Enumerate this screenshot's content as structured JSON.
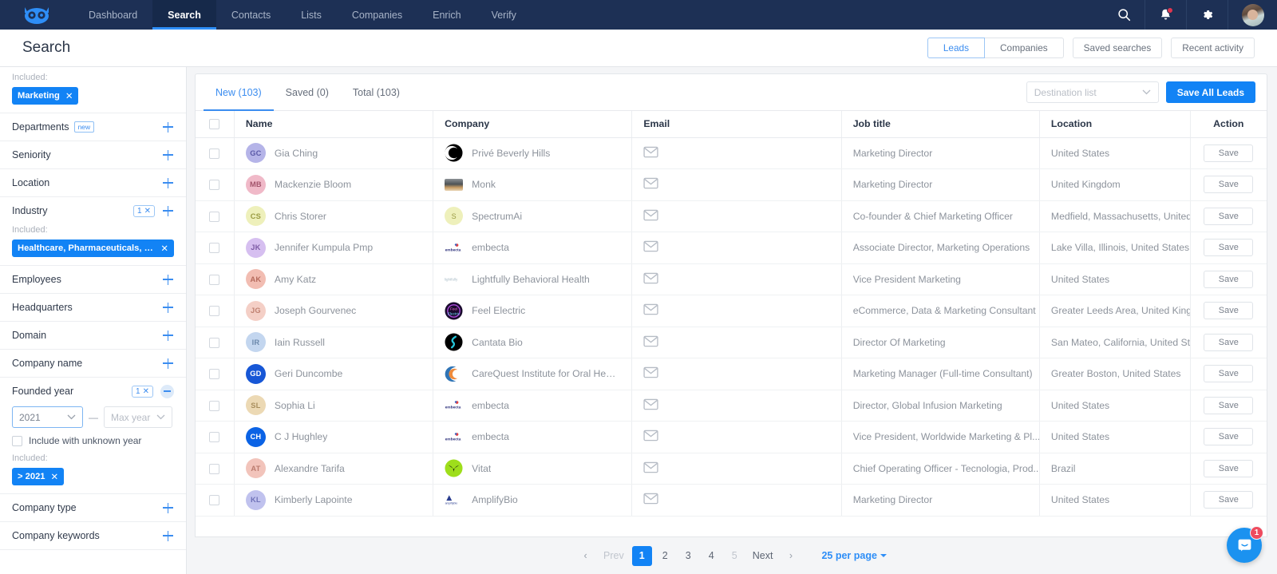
{
  "nav": {
    "logo_icon": "owl-logo-icon",
    "items": [
      {
        "label": "Dashboard",
        "active": false
      },
      {
        "label": "Search",
        "active": true
      },
      {
        "label": "Contacts",
        "active": false
      },
      {
        "label": "Lists",
        "active": false
      },
      {
        "label": "Companies",
        "active": false
      },
      {
        "label": "Enrich",
        "active": false
      },
      {
        "label": "Verify",
        "active": false
      }
    ],
    "icons": [
      "search-icon",
      "notifications-bell-icon",
      "settings-gear-icon",
      "user-avatar"
    ]
  },
  "header": {
    "title": "Search",
    "segmented": [
      {
        "label": "Leads",
        "active": true
      },
      {
        "label": "Companies",
        "active": false
      }
    ],
    "saved_searches": "Saved searches",
    "recent_activity": "Recent activity"
  },
  "sidebar": {
    "included_label": "Included:",
    "top_chip": "Marketing",
    "filters": [
      {
        "name": "Departments",
        "badge": "new",
        "expanded": false,
        "count": null
      },
      {
        "name": "Seniority",
        "badge": null,
        "expanded": false,
        "count": null
      },
      {
        "name": "Location",
        "badge": null,
        "expanded": false,
        "count": null
      },
      {
        "name": "Industry",
        "badge": null,
        "expanded": false,
        "count": "1"
      },
      {
        "name": "Employees",
        "badge": null,
        "expanded": false,
        "count": null
      },
      {
        "name": "Headquarters",
        "badge": null,
        "expanded": false,
        "count": null
      },
      {
        "name": "Domain",
        "badge": null,
        "expanded": false,
        "count": null
      },
      {
        "name": "Company name",
        "badge": null,
        "expanded": false,
        "count": null
      },
      {
        "name": "Founded year",
        "badge": null,
        "expanded": true,
        "count": "1"
      },
      {
        "name": "Company type",
        "badge": null,
        "expanded": false,
        "count": null
      },
      {
        "name": "Company keywords",
        "badge": null,
        "expanded": false,
        "count": null
      }
    ],
    "industry_chip": "Healthcare, Pharmaceuticals, & ...",
    "founded": {
      "min_year_value": "2021",
      "max_year_placeholder": "Max year",
      "unknown_checkbox_label": "Include with unknown year",
      "chip": "> 2021"
    }
  },
  "toolbar": {
    "tabs": [
      {
        "label": "New (103)",
        "active": true
      },
      {
        "label": "Saved (0)",
        "active": false
      },
      {
        "label": "Total (103)",
        "active": false
      }
    ],
    "destination_placeholder": "Destination list",
    "save_all_label": "Save All Leads"
  },
  "table": {
    "columns": [
      "Name",
      "Company",
      "Email",
      "Job title",
      "Location",
      "Action"
    ],
    "action_label": "Save",
    "rows": [
      {
        "initials": "GC",
        "av_bg": "#b5b4e8",
        "av_fg": "#5b5aa8",
        "name": "Gia Ching",
        "company": "Privé Beverly Hills",
        "logo": "prive-logo",
        "job": "Marketing Director",
        "location": "United States"
      },
      {
        "initials": "MB",
        "av_bg": "#f0b9c8",
        "av_fg": "#a3536b",
        "name": "Mackenzie Bloom",
        "company": "Monk",
        "logo": "monk-logo",
        "job": "Marketing Director",
        "location": "United Kingdom"
      },
      {
        "initials": "CS",
        "av_bg": "#eef0bb",
        "av_fg": "#9a9b42",
        "name": "Chris Storer",
        "company": "SpectrumAi",
        "logo": "spectrumai-logo",
        "job": "Co-founder & Chief Marketing Officer",
        "location": "Medfield, Massachusetts, United States"
      },
      {
        "initials": "JK",
        "av_bg": "#d6bff0",
        "av_fg": "#7d5aa5",
        "name": "Jennifer Kumpula Pmp",
        "company": "embecta",
        "logo": "embecta-logo",
        "job": "Associate Director, Marketing Operations",
        "location": "Lake Villa, Illinois, United States"
      },
      {
        "initials": "AK",
        "av_bg": "#f2bdb2",
        "av_fg": "#b56a5c",
        "name": "Amy Katz",
        "company": "Lightfully Behavioral Health",
        "logo": "lightfully-logo",
        "job": "Vice President Marketing",
        "location": "United States"
      },
      {
        "initials": "JG",
        "av_bg": "#f4cfc6",
        "av_fg": "#bf8070",
        "name": "Joseph Gourvenec",
        "company": "Feel Electric",
        "logo": "feelelectric-logo",
        "job": "eCommerce, Data & Marketing Consultant",
        "location": "Greater Leeds Area, United Kingdom"
      },
      {
        "initials": "IR",
        "av_bg": "#c3d6ef",
        "av_fg": "#6b88ab",
        "name": "Iain Russell",
        "company": "Cantata Bio",
        "logo": "cantatabio-logo",
        "job": "Director Of Marketing",
        "location": "San Mateo, California, United States"
      },
      {
        "initials": "GD",
        "av_bg": "#1757d6",
        "av_fg": "#ffffff",
        "name": "Geri Duncombe",
        "company": "CareQuest Institute for Oral Health",
        "logo": "carequest-logo",
        "job": "Marketing Manager (Full-time Consultant)",
        "location": "Greater Boston, United States"
      },
      {
        "initials": "SL",
        "av_bg": "#ecd9b4",
        "av_fg": "#a98f5e",
        "name": "Sophia Li",
        "company": "embecta",
        "logo": "embecta-logo",
        "job": "Director, Global Infusion Marketing",
        "location": "United States"
      },
      {
        "initials": "CH",
        "av_bg": "#0b63e5",
        "av_fg": "#ffffff",
        "name": "C J Hughley",
        "company": "embecta",
        "logo": "embecta-logo",
        "job": "Vice President, Worldwide Marketing & Pl...",
        "location": "United States"
      },
      {
        "initials": "AT",
        "av_bg": "#f2c4bb",
        "av_fg": "#bb7b6e",
        "name": "Alexandre Tarifa",
        "company": "Vitat",
        "logo": "vitat-logo",
        "job": "Chief Operating Officer - Tecnologia, Prod...",
        "location": "Brazil"
      },
      {
        "initials": "KL",
        "av_bg": "#c0c2ee",
        "av_fg": "#6f72b8",
        "name": "Kimberly Lapointe",
        "company": "AmplifyBio",
        "logo": "amplifybio-logo",
        "job": "Marketing Director",
        "location": "United States"
      }
    ]
  },
  "pagination": {
    "prev": "Prev",
    "pages": [
      "1",
      "2",
      "3",
      "4",
      "5"
    ],
    "active_page": "1",
    "next": "Next",
    "per_page": "25 per page"
  },
  "chat": {
    "badge": "1",
    "icon": "intercom-chat-icon"
  }
}
